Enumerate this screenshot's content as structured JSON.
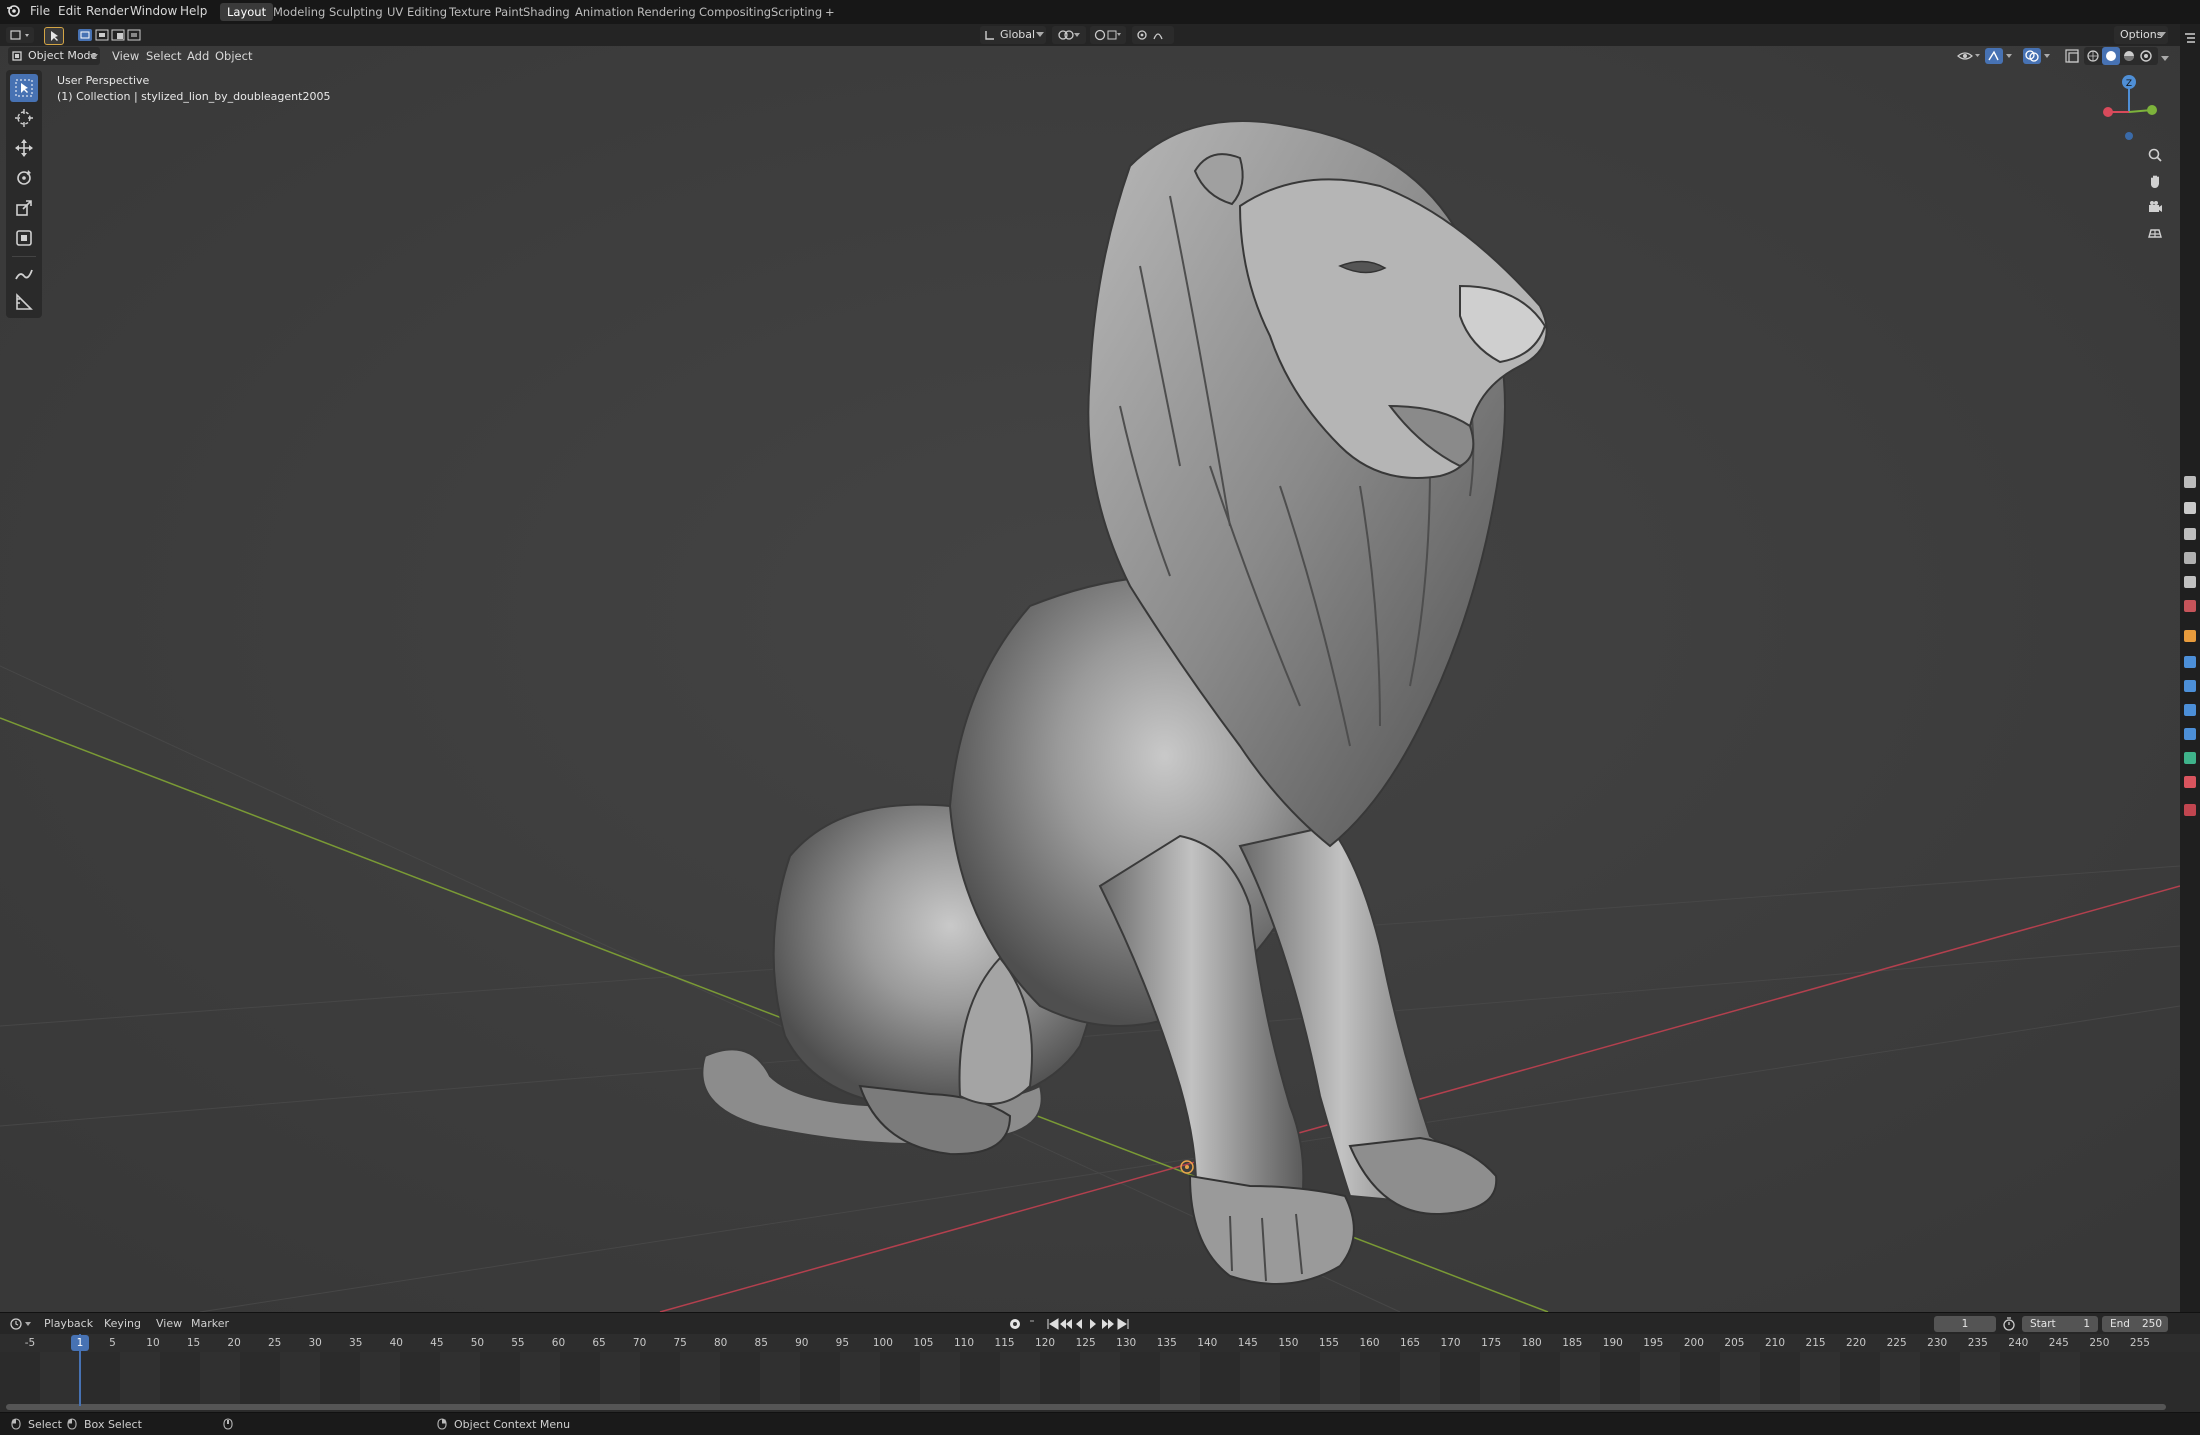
{
  "menubar": {
    "items": [
      "File",
      "Edit",
      "Render",
      "Window",
      "Help"
    ],
    "workspaces": [
      "Layout",
      "Modeling",
      "Sculpting",
      "UV Editing",
      "Texture Paint",
      "Shading",
      "Animation",
      "Rendering",
      "Compositing",
      "Scripting"
    ],
    "active_workspace": "Layout",
    "add_tab": "+"
  },
  "tool_header": {
    "transform_orientation": "Global",
    "options_label": "Options"
  },
  "viewport_header": {
    "mode": "Object Mode",
    "menus": [
      "View",
      "Select",
      "Add",
      "Object"
    ]
  },
  "viewport": {
    "perspective_label": "User Perspective",
    "collection_label": "(1) Collection | stylized_lion_by_doubleagent2005",
    "gizmo_z_label": "Z",
    "object_icon": "lion-sculpture-mesh"
  },
  "timeline": {
    "menus": [
      "Playback",
      "Keying",
      "View",
      "Marker"
    ],
    "current_frame": "1",
    "start_label": "Start",
    "start_value": "1",
    "end_label": "End",
    "end_value": "250",
    "ticks": [
      "-5",
      "1",
      "5",
      "10",
      "15",
      "20",
      "25",
      "30",
      "35",
      "40",
      "45",
      "50",
      "55",
      "60",
      "65",
      "70",
      "75",
      "80",
      "85",
      "90",
      "95",
      "100",
      "105",
      "110",
      "115",
      "120",
      "125",
      "130",
      "135",
      "140",
      "145",
      "150",
      "155",
      "160",
      "165",
      "170",
      "175",
      "180",
      "185",
      "190",
      "195",
      "200",
      "205",
      "210",
      "215",
      "220",
      "225",
      "230",
      "235",
      "240",
      "245",
      "250",
      "255"
    ],
    "playhead_frame": 1
  },
  "statusbar": {
    "select": "Select",
    "box_select": "Box Select",
    "context_menu": "Object Context Menu"
  },
  "colors": {
    "accent": "#4772b3",
    "viewport_bg": "#3d3d3d",
    "axis_x": "#b3404e",
    "axis_y": "#7a9a35"
  }
}
